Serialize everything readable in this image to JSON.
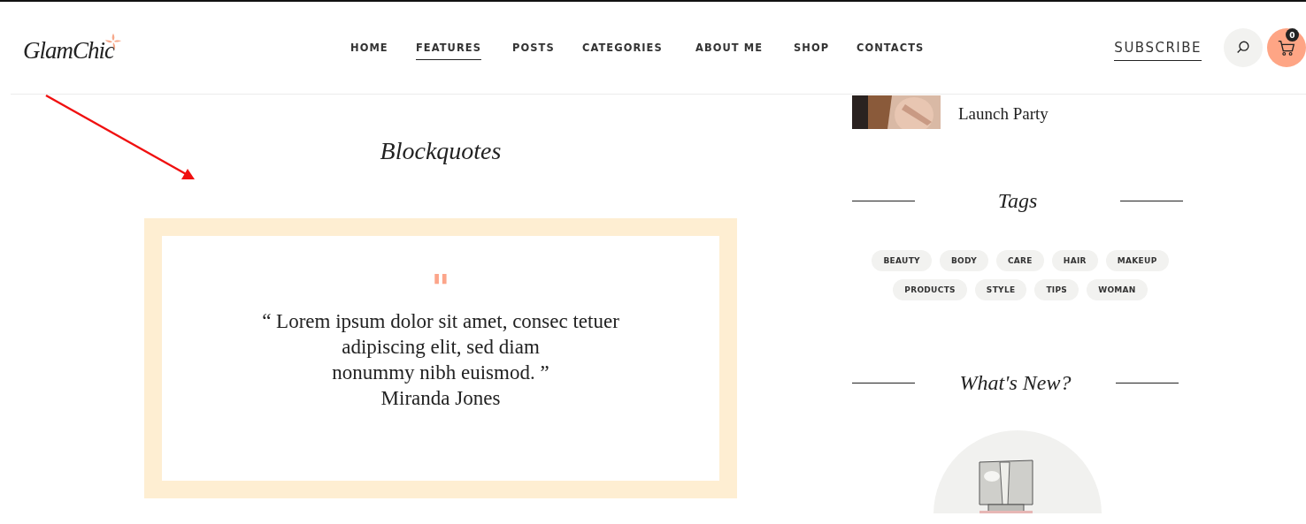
{
  "header": {
    "logo": "GlamChic",
    "nav": [
      {
        "label": "HOME",
        "selected": false
      },
      {
        "label": "FEATURES",
        "selected": true
      },
      {
        "label": "POSTS",
        "selected": false
      },
      {
        "label": "CATEGORIES",
        "selected": false
      },
      {
        "label": "ABOUT ME",
        "selected": false
      },
      {
        "label": "SHOP",
        "selected": false
      },
      {
        "label": "CONTACTS",
        "selected": false
      }
    ],
    "subscribe": "SUBSCRIBE",
    "cart_count": "0"
  },
  "main": {
    "title": "Blockquotes",
    "quote_mark": "\"",
    "quote": "“ Lorem ipsum dolor sit amet, consec tetuer\nadipiscing elit, sed diam\nnonummy nibh euismod. ”",
    "author": "Miranda Jones"
  },
  "sidebar": {
    "post": {
      "title": "Launch Party"
    },
    "tags_title": "Tags",
    "tags": [
      "BEAUTY",
      "BODY",
      "CARE",
      "HAIR",
      "MAKEUP",
      "PRODUCTS",
      "STYLE",
      "TIPS",
      "WOMAN"
    ],
    "new_title": "What's New?"
  }
}
